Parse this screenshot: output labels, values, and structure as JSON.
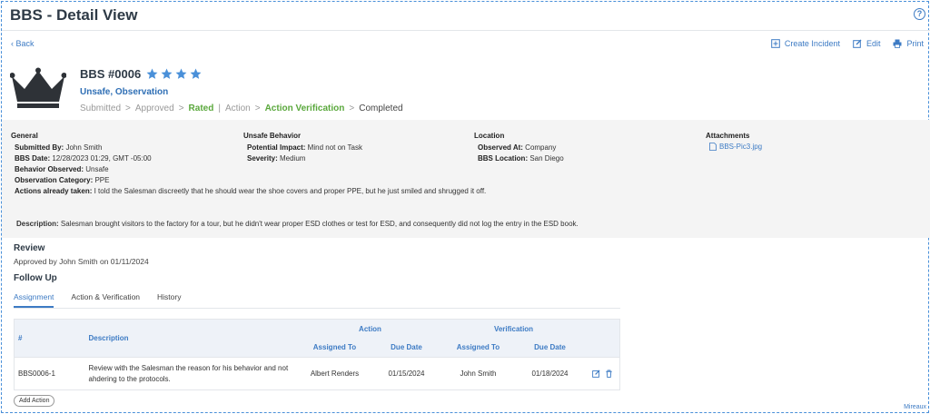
{
  "header": {
    "title": "BBS - Detail View",
    "help_label": "?"
  },
  "nav": {
    "back_label": "Back"
  },
  "toolbar": {
    "create_incident": "Create Incident",
    "edit": "Edit",
    "print": "Print"
  },
  "record": {
    "id_label": "BBS #0006",
    "rating_stars": 4,
    "type_label": "Unsafe, Observation",
    "icon": "crown-icon"
  },
  "workflow": {
    "steps": [
      {
        "label": "Submitted",
        "state": "past",
        "sep": ">"
      },
      {
        "label": "Approved",
        "state": "past",
        "sep": ">"
      },
      {
        "label": "Rated",
        "state": "current",
        "sep": "|"
      },
      {
        "label": "Action",
        "state": "past",
        "sep": ">"
      },
      {
        "label": "Action Verification",
        "state": "current",
        "sep": ">"
      },
      {
        "label": "Completed",
        "state": "done",
        "sep": ""
      }
    ]
  },
  "general": {
    "heading": "General",
    "fields": [
      {
        "label": "Submitted By:",
        "value": "John Smith"
      },
      {
        "label": "BBS Date:",
        "value": "12/28/2023 01:29, GMT -05:00"
      },
      {
        "label": "Behavior Observed:",
        "value": "Unsafe"
      },
      {
        "label": "Observation Category:",
        "value": "PPE"
      },
      {
        "label": "Actions already taken:",
        "value": "I told the Salesman discreetly that he should wear the shoe covers and proper PPE, but he just smiled and shrugged it off."
      }
    ]
  },
  "unsafe_behavior": {
    "heading": "Unsafe Behavior",
    "fields": [
      {
        "label": "Potential Impact:",
        "value": "Mind not on Task"
      },
      {
        "label": "Severity:",
        "value": "Medium"
      }
    ]
  },
  "location": {
    "heading": "Location",
    "fields": [
      {
        "label": "Observed At:",
        "value": "Company"
      },
      {
        "label": "BBS Location:",
        "value": "San Diego"
      }
    ]
  },
  "attachments": {
    "heading": "Attachments",
    "files": [
      "BBS-Pic3.jpg"
    ]
  },
  "description": {
    "label": "Description:",
    "value": "Salesman brought visitors to the factory for a tour, but he didn't wear proper ESD clothes or test for ESD, and consequently did not log the entry in the ESD book."
  },
  "review": {
    "heading": "Review",
    "text": "Approved by John Smith on 01/11/2024"
  },
  "follow_up": {
    "heading": "Follow Up",
    "tabs": [
      {
        "label": "Assignment",
        "active": true
      },
      {
        "label": "Action & Verification",
        "active": false
      },
      {
        "label": "History",
        "active": false
      }
    ],
    "table": {
      "col_num": "#",
      "col_desc": "Description",
      "group_action": "Action",
      "group_verification": "Verification",
      "sub_assigned": "Assigned To",
      "sub_due": "Due Date",
      "rows": [
        {
          "num": "BBS0006-1",
          "description": "Review with the Salesman the reason for his behavior and not ahdering to the protocols.",
          "action_assigned": "Albert Renders",
          "action_due": "01/15/2024",
          "verif_assigned": "John Smith",
          "verif_due": "01/18/2024"
        }
      ]
    },
    "add_action_label": "Add Action"
  },
  "footer": {
    "watermark": "Mireaux"
  },
  "colors": {
    "accent": "#3d7bc4",
    "green": "#5aa83c",
    "star": "#4a90d9"
  }
}
